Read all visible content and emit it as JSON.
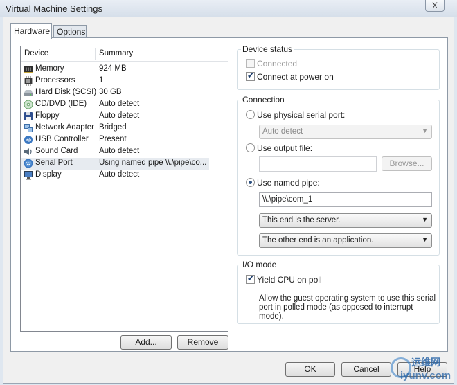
{
  "window": {
    "title": "Virtual Machine Settings",
    "close_glyph": "X"
  },
  "tabs": [
    {
      "label": "Hardware"
    },
    {
      "label": "Options"
    }
  ],
  "device_list": {
    "columns": {
      "device": "Device",
      "summary": "Summary"
    },
    "rows": [
      {
        "name": "Memory",
        "summary": "924 MB",
        "icon": "memory-icon"
      },
      {
        "name": "Processors",
        "summary": "1",
        "icon": "processor-icon"
      },
      {
        "name": "Hard Disk (SCSI)",
        "summary": "30 GB",
        "icon": "hard-disk-icon"
      },
      {
        "name": "CD/DVD (IDE)",
        "summary": "Auto detect",
        "icon": "cd-dvd-icon"
      },
      {
        "name": "Floppy",
        "summary": "Auto detect",
        "icon": "floppy-icon"
      },
      {
        "name": "Network Adapter",
        "summary": "Bridged",
        "icon": "network-adapter-icon"
      },
      {
        "name": "USB Controller",
        "summary": "Present",
        "icon": "usb-icon"
      },
      {
        "name": "Sound Card",
        "summary": "Auto detect",
        "icon": "sound-card-icon"
      },
      {
        "name": "Serial Port",
        "summary": "Using named pipe \\\\.\\pipe\\co...",
        "icon": "serial-port-icon",
        "selected": true
      },
      {
        "name": "Display",
        "summary": "Auto detect",
        "icon": "display-icon"
      }
    ],
    "add_label": "Add...",
    "remove_label": "Remove"
  },
  "device_status": {
    "title": "Device status",
    "connected_label": "Connected",
    "connected_checked": false,
    "connect_power_label": "Connect at power on",
    "connect_power_checked": true
  },
  "connection": {
    "title": "Connection",
    "physical_label": "Use physical serial port:",
    "physical_value": "Auto detect",
    "output_file_label": "Use output file:",
    "output_file_value": "",
    "browse_label": "Browse...",
    "named_pipe_label": "Use named pipe:",
    "named_pipe_value": "\\\\.\\pipe\\com_1",
    "this_end_value": "This end is the server.",
    "other_end_value": "The other end is an application.",
    "selected_option": "named_pipe"
  },
  "io_mode": {
    "title": "I/O mode",
    "yield_label": "Yield CPU on poll",
    "yield_checked": true,
    "description_line1": "Allow the guest operating system to use this serial",
    "description_line2": "port in polled mode (as opposed to interrupt mode)."
  },
  "footer": {
    "ok_label": "OK",
    "cancel_label": "Cancel",
    "help_label": "Help"
  },
  "watermark": {
    "line1": "运维网",
    "line2": "iyunv.com"
  },
  "colors": {
    "selection": "#e7ebf0",
    "check": "#1a3a6a",
    "window_bg": "#f0f0f0"
  }
}
